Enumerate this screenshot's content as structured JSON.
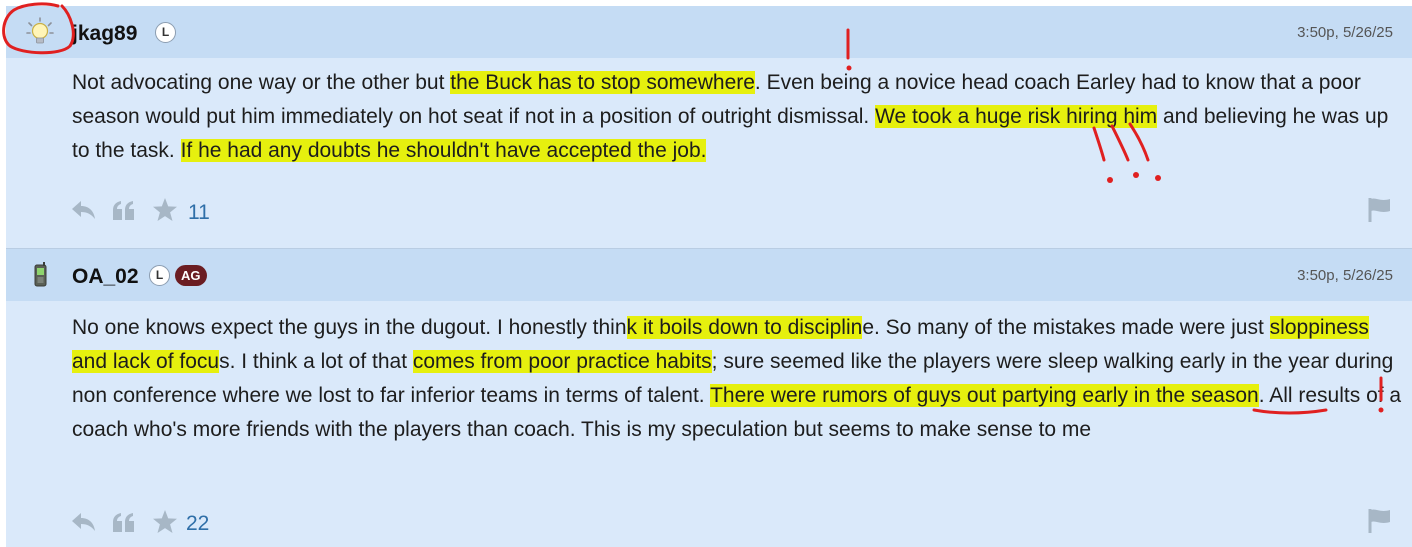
{
  "posts": [
    {
      "username": "jkag89",
      "badge": "L",
      "timestamp": "3:50p, 5/26/25",
      "avatar_icon": "lightbulb-icon",
      "segments": [
        {
          "text": "Not advocating one way or the other but ",
          "hl": false
        },
        {
          "text": "the Buck has to stop somewhere",
          "hl": true
        },
        {
          "text": ". Even being a novice head coach Earley had to know that a poor season would put him immediately on hot seat if not in a position of outright dismissal. ",
          "hl": false
        },
        {
          "text": "We took a huge risk hiring him",
          "hl": true
        },
        {
          "text": " and believing he was up to the task. ",
          "hl": false
        },
        {
          "text": "If he had any doubts he shouldn't have accepted the job.",
          "hl": true
        }
      ],
      "like_count": "11"
    },
    {
      "username": "OA_02",
      "badge": "L",
      "badge2": "AG",
      "timestamp": "3:50p, 5/26/25",
      "avatar_icon": "cellphone-icon",
      "segments": [
        {
          "text": "No one knows expect the guys in the dugout. I honestly thin",
          "hl": false
        },
        {
          "text": "k it boils down to disciplin",
          "hl": true
        },
        {
          "text": "e. So many of the mistakes made were just ",
          "hl": false
        },
        {
          "text": "sloppiness and lack of focu",
          "hl": true
        },
        {
          "text": "s. I think a lot of that ",
          "hl": false
        },
        {
          "text": "comes from poor practice habits",
          "hl": true
        },
        {
          "text": "; sure seemed like the players were sleep walking early in the year during non conference where we lost to far inferior teams in terms of talent. ",
          "hl": false
        },
        {
          "text": "There were rumors of guys out partying early in the season",
          "hl": true
        },
        {
          "text": ". All results of a coach who's more friends with the players than coach. This is my speculation but seems to make sense to me",
          "hl": false
        }
      ],
      "like_count": "22"
    }
  ],
  "colors": {
    "header_bg": "#c5dcf4",
    "body_bg": "#dae9fa",
    "highlight": "#e6f00e",
    "annotation": "#e02020",
    "count": "#2f6fa8",
    "action_icon": "#a7b7c6",
    "badge_ag": "#6b1d22"
  },
  "icons": [
    "reply-icon",
    "quote-icon",
    "star-icon",
    "flag-icon"
  ]
}
